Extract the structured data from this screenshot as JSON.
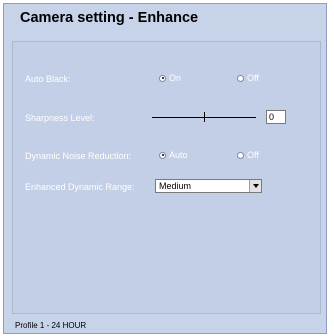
{
  "title": "Camera setting - Enhance",
  "settings": {
    "auto_black": {
      "label": "Auto Black:",
      "options": [
        {
          "label": "On",
          "selected": true
        },
        {
          "label": "Off",
          "selected": false
        }
      ]
    },
    "sharpness": {
      "label": "Sharpness Level:",
      "value": "0"
    },
    "dnr": {
      "label": "Dynamic Noise Reduction:",
      "options": [
        {
          "label": "Auto",
          "selected": true
        },
        {
          "label": "Off",
          "selected": false
        }
      ]
    },
    "edr": {
      "label": "Enhanced Dynamic Range:",
      "value": "Medium"
    }
  },
  "footer": "Profile 1 - 24 HOUR"
}
